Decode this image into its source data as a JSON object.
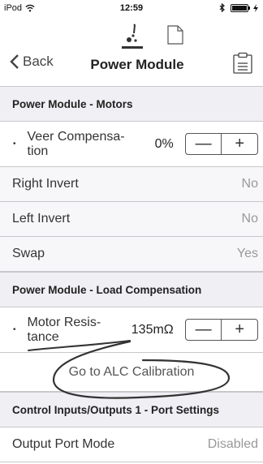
{
  "status_bar": {
    "carrier": "iPod",
    "time": "12:59"
  },
  "nav": {
    "back_label": "Back",
    "title": "Power Module"
  },
  "sections": [
    {
      "header": "Power Module - Motors",
      "stepper": {
        "label_line1": "Veer Compensa-",
        "label_line2": "tion",
        "value": "0%",
        "minus": "—",
        "plus": "+"
      },
      "rows": [
        {
          "label": "Right Invert",
          "value": "No"
        },
        {
          "label": "Left Invert",
          "value": "No"
        },
        {
          "label": "Swap",
          "value": "Yes"
        }
      ]
    },
    {
      "header": "Power Module - Load Compensation",
      "stepper": {
        "label_line1": "Motor Resis-",
        "label_line2": "tance",
        "value": "135mΩ",
        "minus": "—",
        "plus": "+"
      },
      "button": "Go to ALC Calibration"
    },
    {
      "header": "Control Inputs/Outputs 1 - Port Settings",
      "rows": [
        {
          "label": "Output Port Mode",
          "value": "Disabled"
        }
      ]
    }
  ],
  "colors": {
    "section_bg": "#efeff4",
    "separator": "#c8c7cc",
    "annotation": "#333333"
  }
}
